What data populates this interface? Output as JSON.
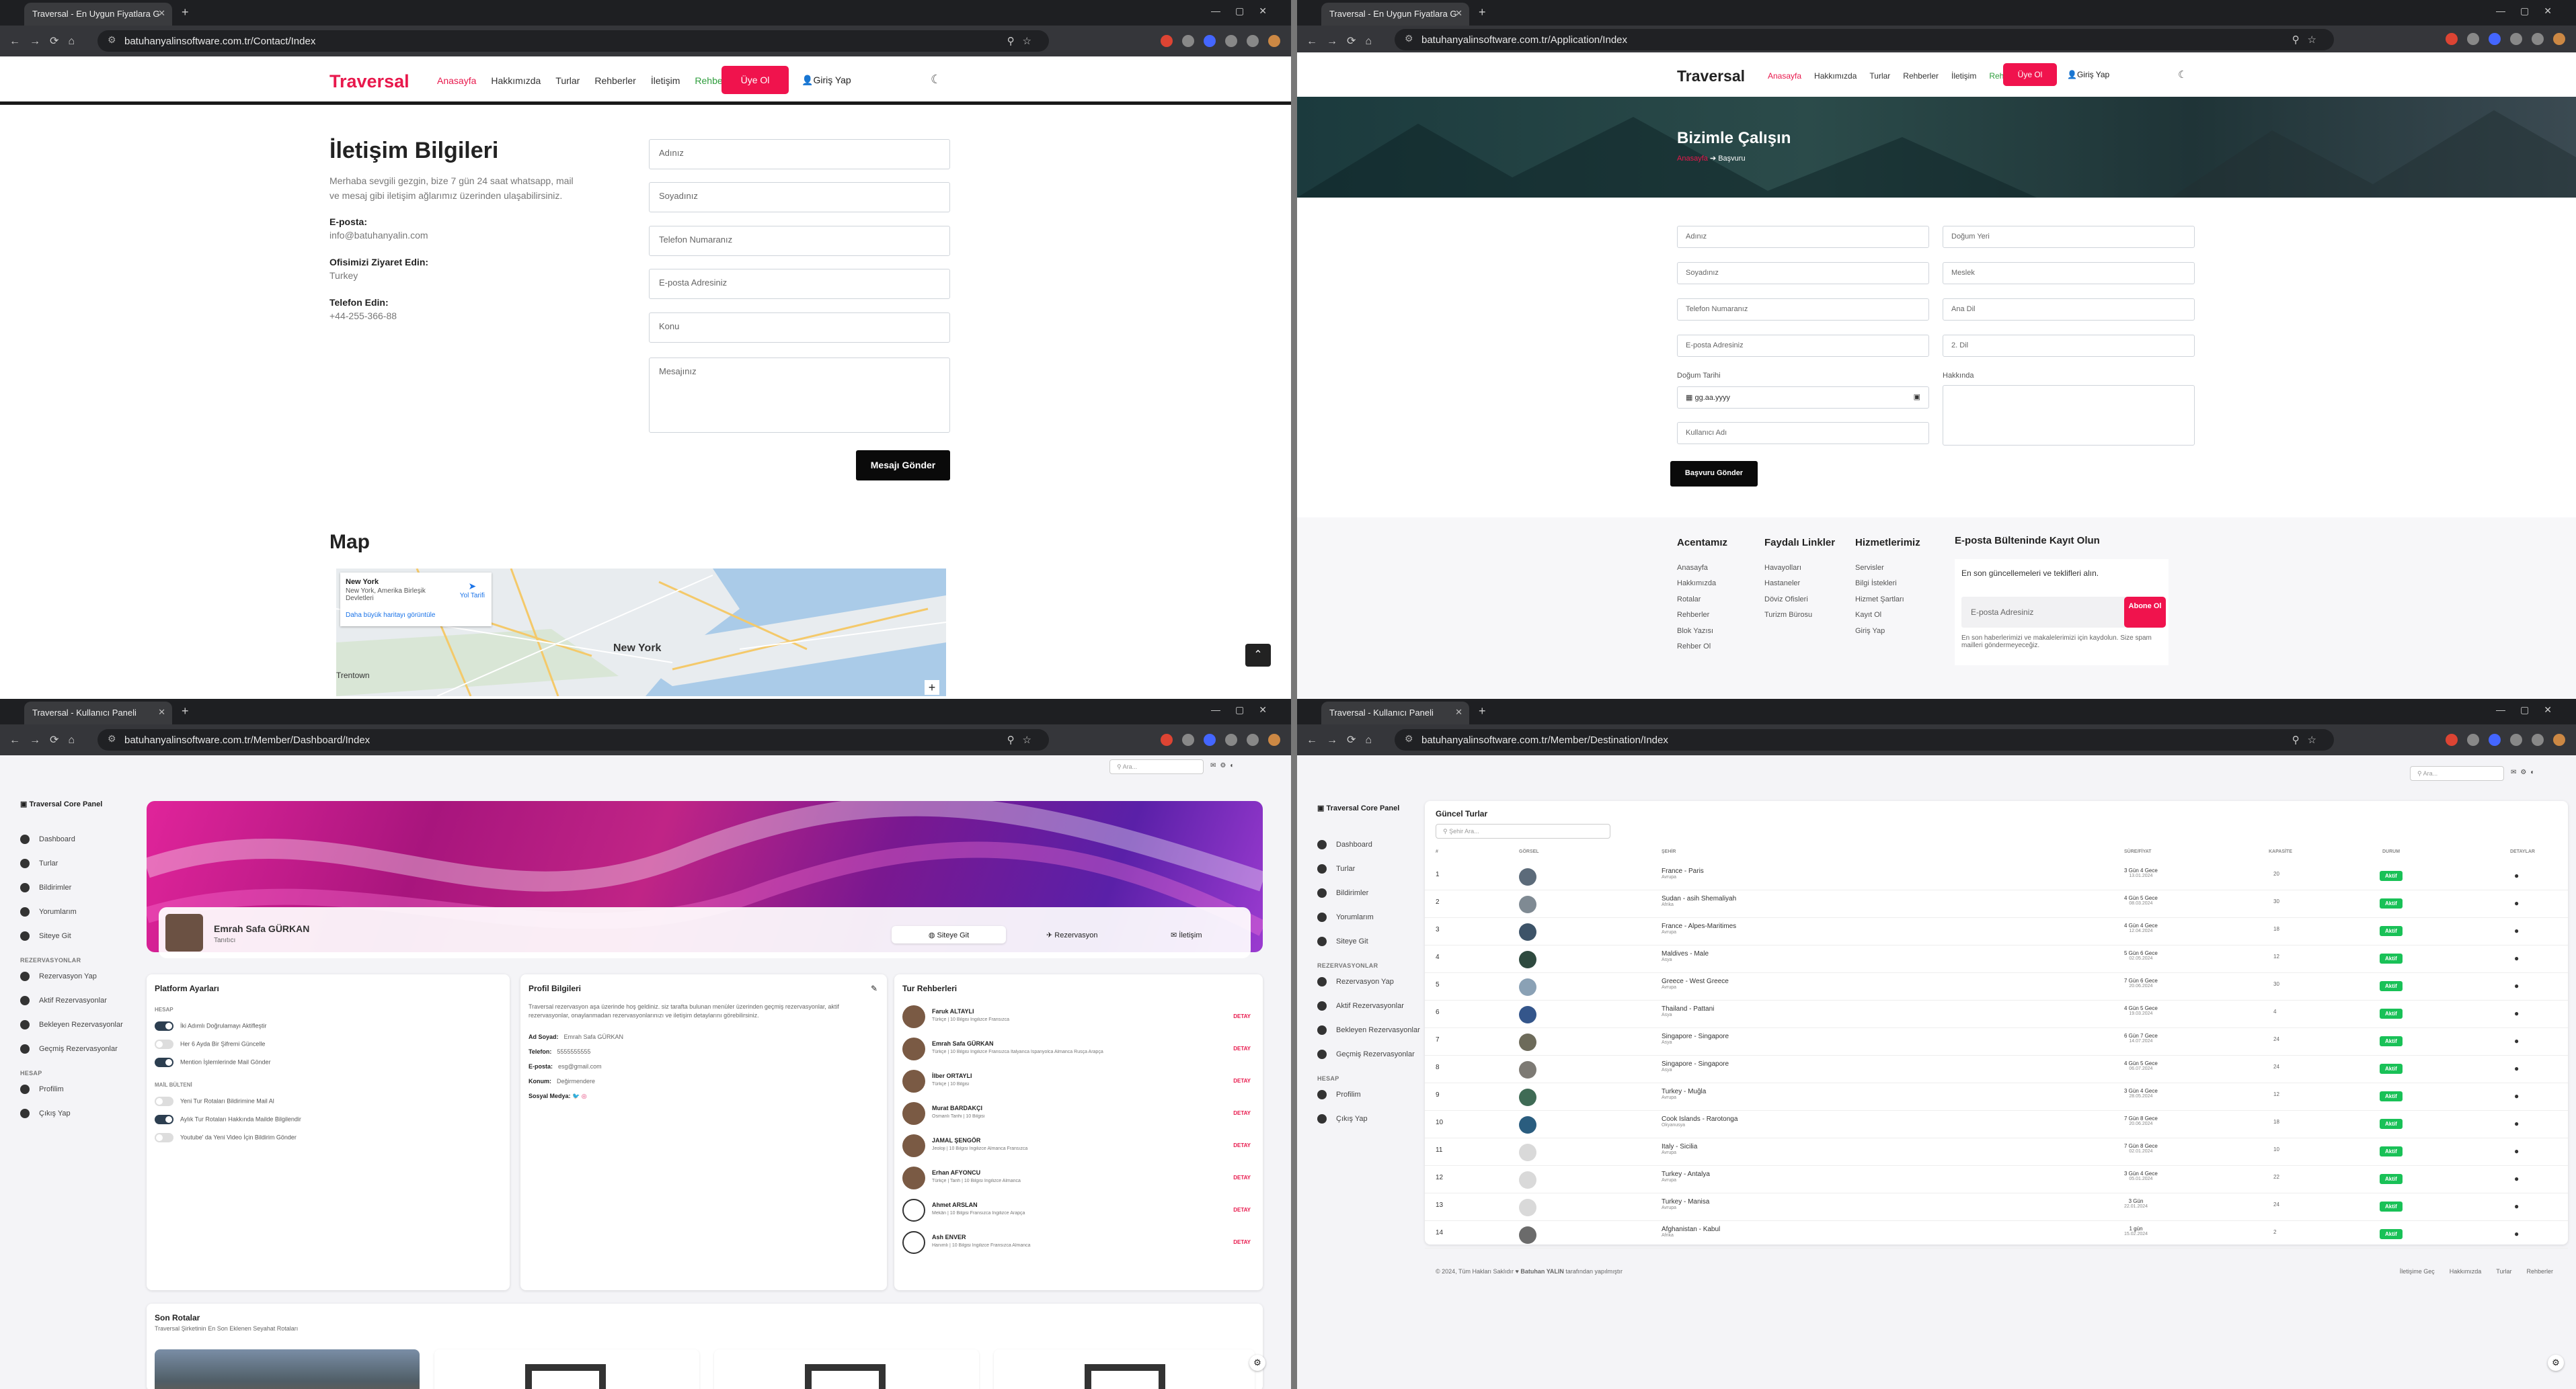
{
  "browser": {
    "tab_title_site": "Traversal - En Uygun Fiyatlara G",
    "tab_title_panel": "Traversal - Kullanıcı Paneli",
    "url_contact": "batuhanyalinsoftware.com.tr/Contact/Index",
    "url_application": "batuhanyalinsoftware.com.tr/Application/Index",
    "url_dashboard": "batuhanyalinsoftware.com.tr/Member/Dashboard/Index",
    "url_destination": "batuhanyalinsoftware.com.tr/Member/Destination/Index"
  },
  "site_nav": {
    "logo": "Traversal",
    "links": [
      "Anasayfa",
      "Hakkımızda",
      "Turlar",
      "Rehberler",
      "İletişim",
      "Rehber Ol"
    ],
    "signup": "Üye Ol",
    "login": "Giriş Yap"
  },
  "contact": {
    "title": "İletişim Bilgileri",
    "intro": "Merhaba sevgili gezgin, bize 7 gün 24 saat whatsapp, mail ve mesaj gibi iletişim ağlarımız üzerinden ulaşabilirsiniz.",
    "email_label": "E-posta:",
    "email": "info@batuhanyalin.com",
    "office_label": "Ofisimizi Ziyaret Edin:",
    "office": "Turkey",
    "phone_label": "Telefon Edin:",
    "phone": "+44-255-366-88",
    "form": {
      "name": "Adınız",
      "surname": "Soyadınız",
      "phone": "Telefon Numaranız",
      "email": "E-posta Adresiniz",
      "subject": "Konu",
      "message": "Mesajınız",
      "submit": "Mesajı Gönder"
    },
    "map_title": "Map",
    "map_place": "New York",
    "map_place_sub": "New York, Amerika Birleşik Devletleri",
    "map_directions": "Yol Tarifi",
    "map_bigger": "Daha büyük haritayı görüntüle",
    "map_city": "New York",
    "map_town": "Trentown"
  },
  "application": {
    "hero_title": "Bizimle Çalışın",
    "crumb_home": "Anasayfa",
    "crumb_current": "Başvuru",
    "left": [
      "Adınız",
      "Soyadınız",
      "Telefon Numaranız",
      "E-posta Adresiniz"
    ],
    "right": [
      "Doğum Yeri",
      "Meslek",
      "Ana Dil",
      "2. Dil"
    ],
    "birth_label": "Doğum Tarihi",
    "birth_placeholder": "gg.aa.yyyy",
    "about_label": "Hakkında",
    "username": "Kullanıcı Adı",
    "submit": "Başvuru Gönder",
    "footer": {
      "col1_title": "Acentamız",
      "col1": [
        "Anasayfa",
        "Hakkımızda",
        "Rotalar",
        "Rehberler",
        "Blok Yazısı",
        "Rehber Ol"
      ],
      "col2_title": "Faydalı Linkler",
      "col2": [
        "Havayolları",
        "Hastaneler",
        "Döviz Ofisleri",
        "Turizm Bürosu"
      ],
      "col3_title": "Hizmetlerimiz",
      "col3": [
        "Servisler",
        "Bilgi İstekleri",
        "Hizmet Şartları",
        "Kayıt Ol",
        "Giriş Yap"
      ],
      "newsletter_title": "E-posta Bülteninde Kayıt Olun",
      "newsletter_text": "En son güncellemeleri ve teklifleri alın.",
      "newsletter_placeholder": "E-posta Adresiniz",
      "newsletter_btn": "Abone Ol",
      "newsletter_note": "En son haberlerimizi ve makalelerimizi için kaydolun. Size spam mailleri göndermeyeceğiz."
    }
  },
  "panel": {
    "brand": "Traversal Core Panel",
    "menu": [
      "Dashboard",
      "Turlar",
      "Bildirimler",
      "Yorumlarım",
      "Siteye Git"
    ],
    "res_head": "REZERVASYONLAR",
    "res_menu": [
      "Rezervasyon Yap",
      "Aktif Rezervasyonlar",
      "Bekleyen Rezervasyonlar",
      "Geçmiş Rezervasyonlar"
    ],
    "acc_head": "HESAP",
    "acc_menu": [
      "Profilim",
      "Çıkış Yap"
    ],
    "search_placeholder": "Ara..."
  },
  "dashboard": {
    "user_name": "Emrah Safa GÜRKAN",
    "user_role": "Tanıtıcı",
    "tab_site": "Siteye Git",
    "tab_res": "Rezervasyon",
    "tab_contact": "İletişim",
    "platform_title": "Platform Ayarları",
    "acc_head": "HESAP",
    "settings_account": [
      {
        "label": "İki Adımlı Doğrulamayı Aktifleştir",
        "on": true
      },
      {
        "label": "Her 6 Ayda Bir Şifremi Güncelle",
        "on": false
      },
      {
        "label": "Mention İşlemlerinde Mail Gönder",
        "on": true
      }
    ],
    "mail_head": "MAİL BÜLTENİ",
    "settings_mail": [
      {
        "label": "Yeni Tur Rotaları Bildirimine Mail Al",
        "on": false
      },
      {
        "label": "Aylık Tur Rotaları Hakkında Mailde Bilgilendir",
        "on": true
      },
      {
        "label": "Youtube' da Yeni Video İçin Bildirim Gönder",
        "on": false
      }
    ],
    "profile_title": "Profil Bilgileri",
    "profile_text": "Traversal rezervasyon aşa üzerinde hoş geldiniz. siz tarafta bulunan menüler üzerinden geçmiş rezervasyonlar, aktif rezervasyonlar, onaylanmadan rezervasyonlarınızı ve iletişim detaylarını görebilirsiniz.",
    "profile": [
      {
        "k": "Ad Soyad:",
        "v": "Emrah Safa GÜRKAN"
      },
      {
        "k": "Telefon:",
        "v": "5555555555"
      },
      {
        "k": "E-posta:",
        "v": "esg@gmail.com"
      },
      {
        "k": "Konum:",
        "v": "Değirmendere"
      }
    ],
    "social_label": "Sosyal Medya:",
    "guides_title": "Tur Rehberleri",
    "guides": [
      {
        "name": "Faruk ALTAYLI",
        "desc": "Türkçe | 10 Bilgisi İngilizce Fransızca"
      },
      {
        "name": "Emrah Safa GÜRKAN",
        "desc": "Türkçe | 10 Bilgisi İngilizce Fransızca İtalyanca İspanyolca Almanca Rusça Arapça"
      },
      {
        "name": "İlber ORTAYLI",
        "desc": "Türkçe | 10 Bilgisi"
      },
      {
        "name": "Murat BARDAKÇI",
        "desc": "Osmanlı Tarihi | 10 Bilgisi"
      },
      {
        "name": "JAMAL ŞENGÖR",
        "desc": "Jeoloji | 10 Bilgisi İngilizce Almanca Fransızca"
      },
      {
        "name": "Erhan AFYONCU",
        "desc": "Türkçe | Tarih | 10 Bilgisi İngilizce Almanca"
      },
      {
        "name": "Ahmet ARSLAN",
        "desc": "Mekân | 10 Bilgisi Fransızca İngilizce Arapça"
      },
      {
        "name": "Ash ENVER",
        "desc": "Hanımlı | 10 Bilgisi İngilizce Fransızca Almanca"
      }
    ],
    "guide_btn": "DETAY",
    "routes_title": "Son Rotalar",
    "routes_sub": "Traversal Şirketinin En Son Eklenen Seyahat Rotaları"
  },
  "destinations": {
    "title": "Güncel Turlar",
    "search_placeholder": "Şehir Ara...",
    "headers": [
      "#",
      "GÖRSEL",
      "ŞEHİR",
      "SÜRE/FİYAT",
      "KAPASİTE",
      "DURUM",
      "DETAYLAR"
    ],
    "rows": [
      {
        "n": "1",
        "city": "France - Paris",
        "region": "Avrupa",
        "dur": "3 Gün 4 Gece",
        "price": "13.01.2024",
        "cap": "20"
      },
      {
        "n": "2",
        "city": "Sudan - asih Shemaliyah",
        "region": "Afrika",
        "dur": "4 Gün 5 Gece",
        "price": "08.03.2024",
        "cap": "30"
      },
      {
        "n": "3",
        "city": "France - Alpes-Maritimes",
        "region": "Avrupa",
        "dur": "4 Gün 4 Gece",
        "price": "12.04.2024",
        "cap": "18"
      },
      {
        "n": "4",
        "city": "Maldives - Male",
        "region": "Asya",
        "dur": "5 Gün 6 Gece",
        "price": "02.05.2024",
        "cap": "12"
      },
      {
        "n": "5",
        "city": "Greece - West Greece",
        "region": "Avrupa",
        "dur": "7 Gün 6 Gece",
        "price": "20.06.2024",
        "cap": "30"
      },
      {
        "n": "6",
        "city": "Thailand - Pattani",
        "region": "Asya",
        "dur": "4 Gün 5 Gece",
        "price": "19.03.2024",
        "cap": "4"
      },
      {
        "n": "7",
        "city": "Singapore - Singapore",
        "region": "Asya",
        "dur": "6 Gün 7 Gece",
        "price": "14.07.2024",
        "cap": "24"
      },
      {
        "n": "8",
        "city": "Singapore - Singapore",
        "region": "Asya",
        "dur": "4 Gün 5 Gece",
        "price": "06.07.2024",
        "cap": "24"
      },
      {
        "n": "9",
        "city": "Turkey - Muğla",
        "region": "Avrupa",
        "dur": "3 Gün 4 Gece",
        "price": "28.05.2024",
        "cap": "12"
      },
      {
        "n": "10",
        "city": "Cook Islands - Rarotonga",
        "region": "Okyanusya",
        "dur": "7 Gün 8 Gece",
        "price": "20.06.2024",
        "cap": "18"
      },
      {
        "n": "11",
        "city": "Italy - Sicilia",
        "region": "Avrupa",
        "dur": "7 Gün 8 Gece",
        "price": "02.01.2024",
        "cap": "10"
      },
      {
        "n": "12",
        "city": "Turkey - Antalya",
        "region": "Avrupa",
        "dur": "3 Gün 4 Gece",
        "price": "05.01.2024",
        "cap": "22"
      },
      {
        "n": "13",
        "city": "Turkey - Manisa",
        "region": "Avrupa",
        "dur": "3 Gün",
        "price": "22.01.2024",
        "cap": "24"
      },
      {
        "n": "14",
        "city": "Afghanistan - Kabul",
        "region": "Afrika",
        "dur": "1 gün",
        "price": "15.02.2024",
        "cap": "2"
      }
    ],
    "status": "Aktif",
    "footer_left": "© 2024, Tüm Hakları Saklıdır",
    "footer_author": "Batuhan YALIN",
    "footer_suffix": "tarafından yapılmıştır",
    "footer_links": [
      "İletişime Geç",
      "Hakkımızda",
      "Turlar",
      "Rehberler"
    ]
  },
  "colors": {
    "accent": "#e8184c",
    "green": "#19c157",
    "dark": "#1e1f22"
  }
}
